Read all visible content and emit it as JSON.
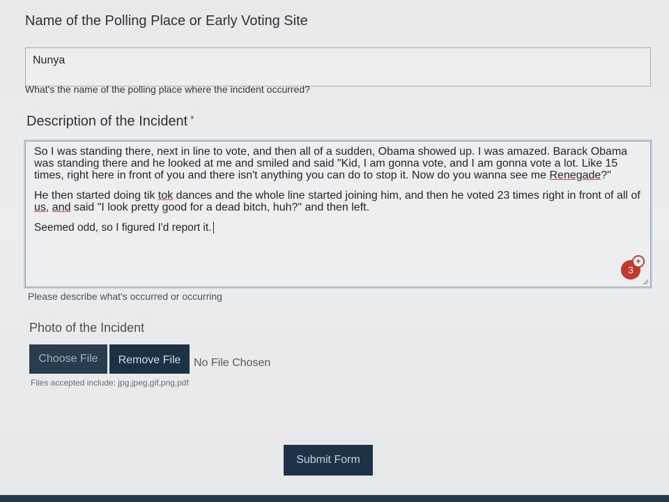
{
  "polling_place": {
    "label": "Name of the Polling Place or Early Voting Site",
    "value": "Nunya",
    "help": "What's the name of the polling place where the incident occurred?"
  },
  "description": {
    "label": "Description of the Incident",
    "required_marker": "*",
    "paragraph_1": "So I was standing there, next in line to vote, and then all of a sudden, Obama showed up. I was amazed. Barack Obama was standing there and he looked at me and smiled and said \"Kid, I am gonna vote, and I am gonna vote a lot. Like 15 times, right here in front of you and there isn't anything you can do to stop it. Now do you wanna see me ",
    "paragraph_1_underlined": "Renegade",
    "paragraph_1_end": "?\"",
    "paragraph_2_a": "He then started doing tik ",
    "paragraph_2_tok": "tok",
    "paragraph_2_b": " dances and the whole line started joining him, and then he voted 23 times right in front of all of ",
    "paragraph_2_us": "us",
    "paragraph_2_c": ", ",
    "paragraph_2_and": "and",
    "paragraph_2_d": " said \"I look pretty good for a dead bitch, huh?\" and then left.",
    "paragraph_3": "Seemed odd, so I figured I'd report it.",
    "badge_count": "3",
    "badge_plus": "+",
    "help": "Please describe what's occurred or occurring"
  },
  "photo": {
    "label": "Photo of the Incident",
    "choose_label": "Choose File",
    "remove_label": "Remove File",
    "status": "No File Chosen",
    "help": "Files accepted include: jpg,jpeg,gif,png,pdf"
  },
  "submit_label": "Submit Form",
  "colors": {
    "button_bg": "#1f3447",
    "badge": "#c23a2f",
    "page_bg": "#e9ebec"
  }
}
